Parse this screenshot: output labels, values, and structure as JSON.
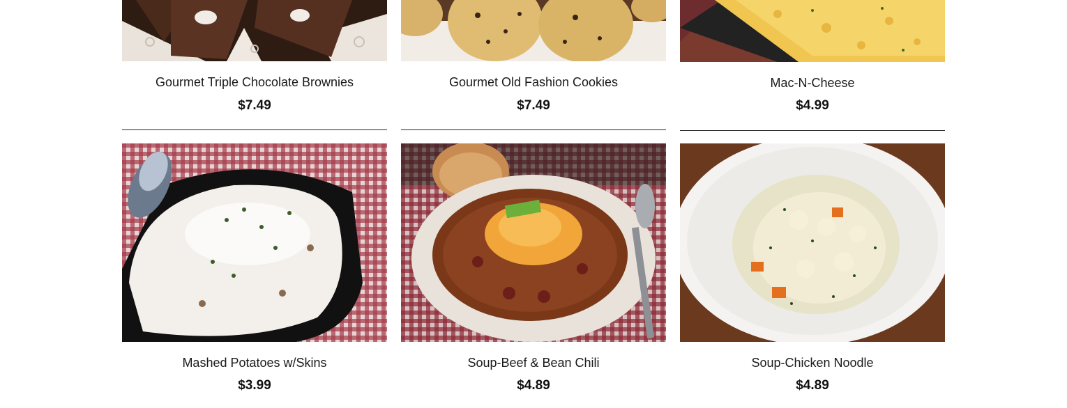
{
  "products": [
    {
      "name": "Gourmet Triple Chocolate Brownies",
      "price": "$7.49",
      "image": "brownies-photo"
    },
    {
      "name": "Gourmet Old Fashion Cookies",
      "price": "$7.49",
      "image": "cookies-photo"
    },
    {
      "name": "Mac-N-Cheese",
      "price": "$4.99",
      "image": "mac-n-cheese-photo"
    },
    {
      "name": "Mashed Potatoes w/Skins",
      "price": "$3.99",
      "image": "mashed-potatoes-photo"
    },
    {
      "name": "Soup-Beef & Bean Chili",
      "price": "$4.89",
      "image": "chili-photo"
    },
    {
      "name": "Soup-Chicken Noodle",
      "price": "$4.89",
      "image": "chicken-noodle-photo"
    }
  ]
}
